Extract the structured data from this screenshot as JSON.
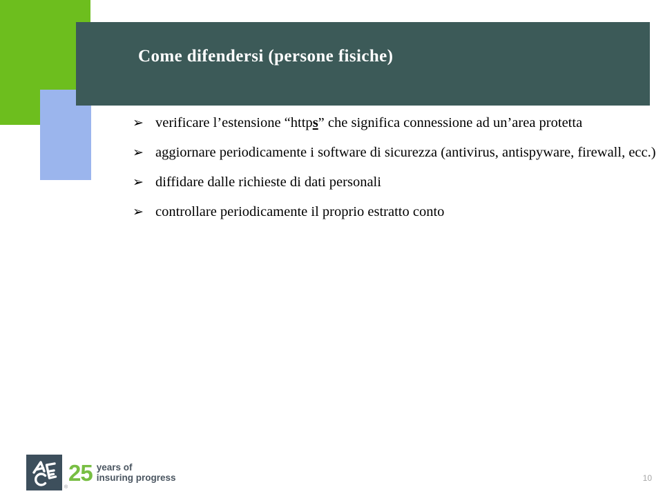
{
  "slide": {
    "title": "Come difendersi (persone fisiche)",
    "page_number": "10",
    "colors": {
      "accent_green": "#6DBE1E",
      "accent_blue": "#9BB5ED",
      "title_band": "#3C5A58",
      "title_text": "#FFFFFF",
      "body_text": "#000000",
      "logo_square": "#3D4F5C",
      "logo_green": "#78BE43",
      "logo_gray": "#4A5560",
      "page_number": "#A6A6A6"
    },
    "bullets": [
      {
        "marker": "➢",
        "parts": [
          {
            "text": "verificare l’estensione “http",
            "style": "normal"
          },
          {
            "text": "s",
            "style": "bold-underline"
          },
          {
            "text": "” che significa connessione ad un’area protetta",
            "style": "normal"
          }
        ],
        "plain": "verificare l’estensione “https” che significa connessione ad un’area protetta",
        "multiline": true
      },
      {
        "marker": "➢",
        "parts": [
          {
            "text": "aggiornare periodicamente i software di sicurezza (antivirus, antispyware, firewall, ecc.)",
            "style": "normal"
          }
        ],
        "plain": "aggiornare periodicamente i software di sicurezza (antivirus, antispyware, firewall, ecc.)",
        "multiline": true
      },
      {
        "marker": "➢",
        "parts": [
          {
            "text": "diffidare dalle richieste di dati personali",
            "style": "normal"
          }
        ],
        "plain": "diffidare dalle richieste di dati personali",
        "multiline": false
      },
      {
        "marker": "➢",
        "parts": [
          {
            "text": "controllare periodicamente il proprio estratto conto",
            "style": "normal"
          }
        ],
        "plain": "controllare periodicamente il proprio estratto conto",
        "multiline": false
      }
    ]
  },
  "footer": {
    "logo_monogram": "ACE",
    "registered_mark": "®",
    "anniversary_number": "25",
    "tagline_line1": "years of",
    "tagline_line2": "insuring progress"
  }
}
